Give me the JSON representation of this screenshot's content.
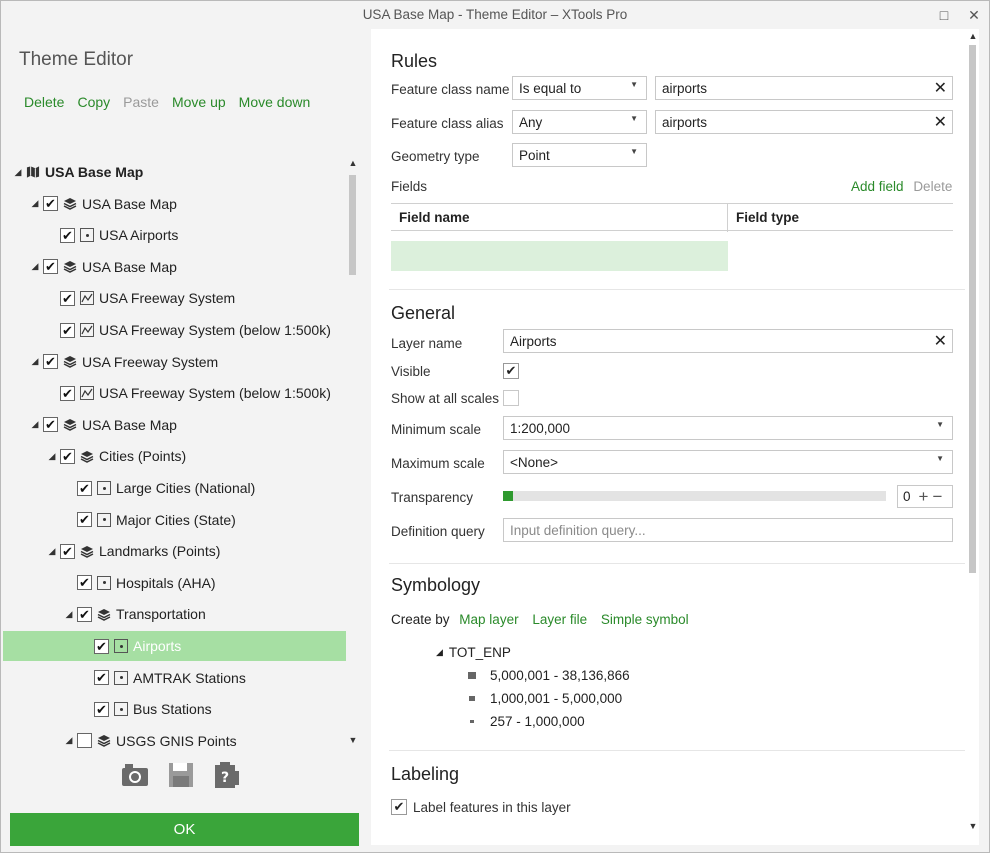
{
  "window": {
    "title": "USA Base Map - Theme Editor – XTools Pro",
    "maximize_icon": "□",
    "close_icon": "✕"
  },
  "left": {
    "heading": "Theme Editor",
    "toolbar": {
      "delete": "Delete",
      "copy": "Copy",
      "paste": "Paste",
      "move_up": "Move up",
      "move_down": "Move down"
    },
    "tree": [
      {
        "label": "USA Base Map",
        "level": 0,
        "checkbox": false,
        "icon": "map-icon",
        "bold": true
      },
      {
        "label": "USA Base Map",
        "level": 1,
        "checkbox": true,
        "icon": "layers-icon"
      },
      {
        "label": "USA Airports",
        "level": 2,
        "checkbox": true,
        "icon": "point-layer-icon"
      },
      {
        "label": "USA Base Map",
        "level": 1,
        "checkbox": true,
        "icon": "layers-icon"
      },
      {
        "label": "USA Freeway System",
        "level": 2,
        "checkbox": true,
        "icon": "line-layer-icon"
      },
      {
        "label": "USA Freeway System (below 1:500k)",
        "level": 2,
        "checkbox": true,
        "icon": "line-layer-icon"
      },
      {
        "label": "USA Freeway System",
        "level": 1,
        "checkbox": true,
        "icon": "layers-icon"
      },
      {
        "label": "USA Freeway System (below 1:500k)",
        "level": 2,
        "checkbox": true,
        "icon": "line-layer-icon"
      },
      {
        "label": "USA Base Map",
        "level": 1,
        "checkbox": true,
        "icon": "layers-icon"
      },
      {
        "label": "Cities (Points)",
        "level": 2,
        "checkbox": true,
        "icon": "layers-icon"
      },
      {
        "label": "Large Cities (National)",
        "level": 3,
        "checkbox": true,
        "icon": "point-layer-icon"
      },
      {
        "label": "Major Cities (State)",
        "level": 3,
        "checkbox": true,
        "icon": "point-layer-icon"
      },
      {
        "label": "Landmarks (Points)",
        "level": 2,
        "checkbox": true,
        "icon": "layers-icon"
      },
      {
        "label": "Hospitals (AHA)",
        "level": 3,
        "checkbox": true,
        "icon": "point-layer-icon"
      },
      {
        "label": "Transportation",
        "level": 3,
        "checkbox": true,
        "icon": "layers-icon"
      },
      {
        "label": "Airports",
        "level": 4,
        "checkbox": true,
        "icon": "point-layer-icon",
        "selected": true
      },
      {
        "label": "AMTRAK Stations",
        "level": 4,
        "checkbox": true,
        "icon": "point-layer-icon"
      },
      {
        "label": "Bus Stations",
        "level": 4,
        "checkbox": true,
        "icon": "point-layer-icon"
      },
      {
        "label": "USGS GNIS Points",
        "level": 3,
        "checkbox": false,
        "icon": "layers-icon"
      }
    ],
    "ok": "OK"
  },
  "rules": {
    "title": "Rules",
    "feature_class_name": {
      "label": "Feature class name",
      "operator": "Is equal to",
      "value": "airports"
    },
    "feature_class_alias": {
      "label": "Feature class alias",
      "operator": "Any",
      "value": "airports"
    },
    "geometry_type": {
      "label": "Geometry type",
      "value": "Point"
    },
    "fields": {
      "label": "Fields",
      "add": "Add field",
      "delete": "Delete",
      "col_name": "Field name",
      "col_type": "Field type"
    }
  },
  "general": {
    "title": "General",
    "layer_name": {
      "label": "Layer name",
      "value": "Airports"
    },
    "visible": {
      "label": "Visible",
      "checked": true
    },
    "show_all_scales": {
      "label": "Show at all scales",
      "checked": false
    },
    "min_scale": {
      "label": "Minimum scale",
      "value": "1:200,000"
    },
    "max_scale": {
      "label": "Maximum scale",
      "value": "<None>"
    },
    "transparency": {
      "label": "Transparency",
      "value": "0",
      "fraction": 0.0
    },
    "definition_query": {
      "label": "Definition query",
      "placeholder": "Input definition query..."
    }
  },
  "symbology": {
    "title": "Symbology",
    "create_by": "Create by",
    "options": [
      "Map layer",
      "Layer file",
      "Simple symbol"
    ],
    "field": "TOT_ENP",
    "classes": [
      "5,000,001 - 38,136,866",
      "1,000,001 - 5,000,000",
      "257 - 1,000,000"
    ]
  },
  "labeling": {
    "title": "Labeling",
    "label_features": {
      "label": "Label features in this layer",
      "checked": true
    }
  },
  "colors": {
    "accent": "#2a8a2a",
    "ok": "#3aa53a",
    "selected": "#a6dfa3"
  }
}
